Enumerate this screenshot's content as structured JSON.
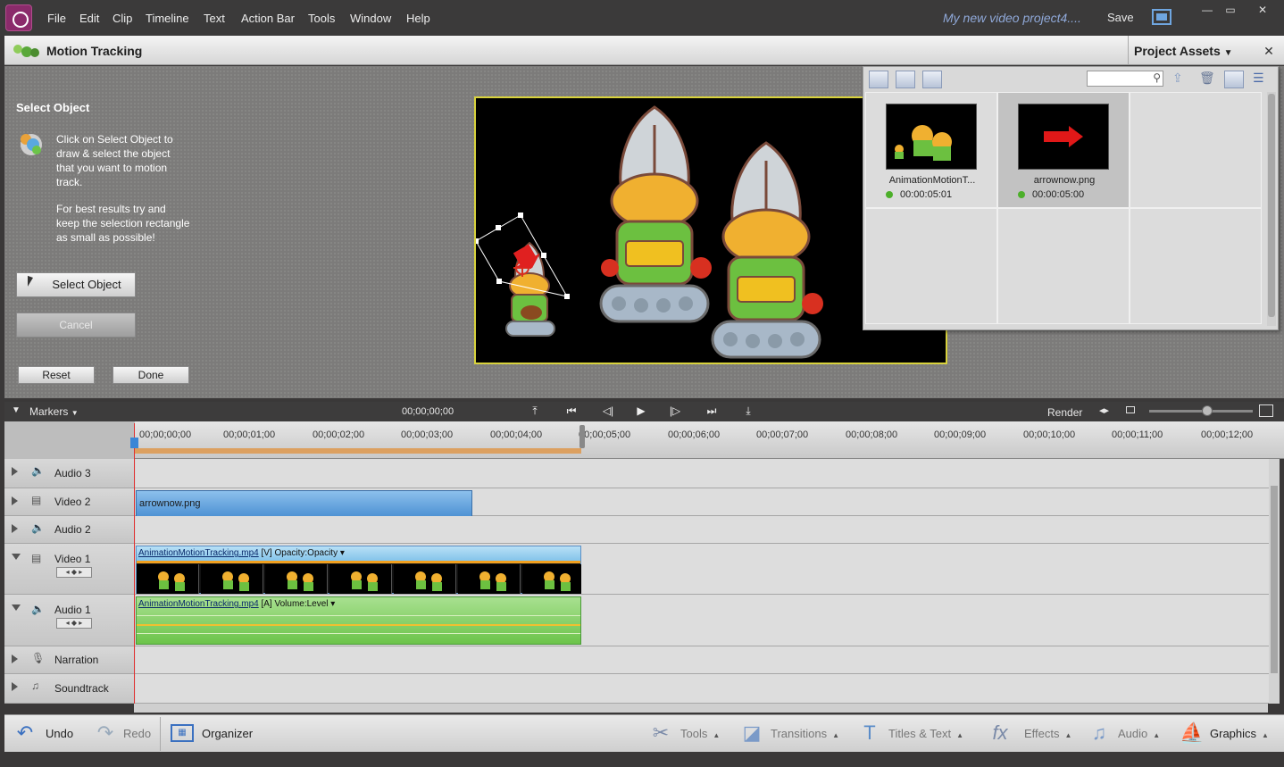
{
  "menubar": {
    "items": [
      "File",
      "Edit",
      "Clip",
      "Timeline",
      "Text",
      "Action Bar",
      "Tools",
      "Window",
      "Help"
    ],
    "project_title": "My new video project4....",
    "save_label": "Save"
  },
  "motion_tracking": {
    "title": "Motion Tracking",
    "select_object_title": "Select Object",
    "help_1": "Click on Select Object to draw & select the object that you want to motion track.",
    "help_2": "For best results try and keep the selection rectangle as small as possible!",
    "select_object_button": "Select Object",
    "cancel_button": "Cancel",
    "reset_button": "Reset",
    "done_button": "Done"
  },
  "project_assets": {
    "title": "Project Assets",
    "close": "✕",
    "items": [
      {
        "name": "AnimationMotionT...",
        "duration": "00:00:05:01"
      },
      {
        "name": "arrownow.png",
        "duration": "00:00:05:00"
      }
    ]
  },
  "timeline": {
    "markers_label": "Markers",
    "timecode": "00;00;00;00",
    "render_label": "Render",
    "ruler": [
      "00;00;00;00",
      "00;00;01;00",
      "00;00;02;00",
      "00;00;03;00",
      "00;00;04;00",
      "00;00;05;00",
      "00;00;06;00",
      "00;00;07;00",
      "00;00;08;00",
      "00;00;09;00",
      "00;00;10;00",
      "00;00;11;00",
      "00;00;12;00"
    ],
    "tracks": [
      "Audio 3",
      "Video 2",
      "Audio 2",
      "Video 1",
      "Audio 1",
      "Narration",
      "Soundtrack"
    ],
    "clips": {
      "video2": "arrownow.png",
      "video1_name": "AnimationMotionTracking.mp4",
      "video1_tag": "[V]",
      "video1_fx": "Opacity:Opacity",
      "audio1_name": "AnimationMotionTracking.mp4",
      "audio1_tag": "[A]",
      "audio1_fx": "Volume:Level"
    }
  },
  "action_bar": {
    "undo": "Undo",
    "redo": "Redo",
    "organizer": "Organizer",
    "tools": "Tools",
    "transitions": "Transitions",
    "titles": "Titles & Text",
    "effects": "Effects",
    "audio": "Audio",
    "graphics": "Graphics"
  }
}
